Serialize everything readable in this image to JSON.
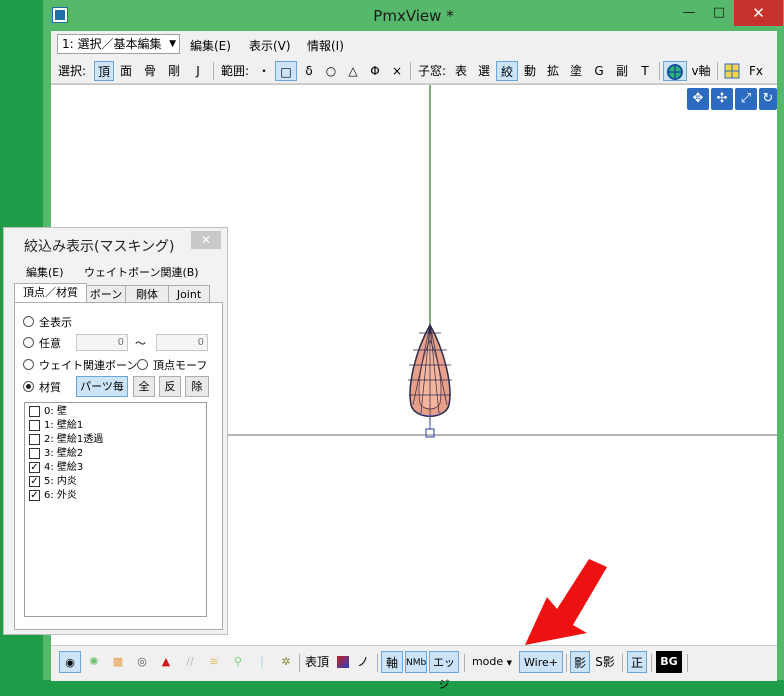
{
  "window": {
    "title": "PmxView *",
    "minimize": "—",
    "maximize": "□",
    "close": "✕"
  },
  "menubar": {
    "mode_select": "1: 選択／基本編集",
    "items": [
      "編集(E)",
      "表示(V)",
      "情報(I)"
    ]
  },
  "toolbar": {
    "select_label": "選択:",
    "select_items": [
      "頂",
      "面",
      "骨",
      "剛",
      "J"
    ],
    "range_label": "範囲:",
    "range_items": [
      "・",
      "□",
      "δ",
      "○",
      "△",
      "Φ",
      "×"
    ],
    "subwin_label": "子窓:",
    "subwin_items": [
      "表",
      "選",
      "絞",
      "動",
      "拡",
      "塗",
      "G",
      "副",
      "T"
    ],
    "v_axis": "v軸",
    "fx": "Fx"
  },
  "viewport": {
    "nav_icons": [
      "move-view-icon",
      "pan-icon",
      "zoom-icon",
      "rotate-icon"
    ]
  },
  "bottombar": {
    "surface_label": "表頂",
    "no_label": "ノ",
    "axis_label": "軸",
    "nm_label": "NMb",
    "edge_label": "エッジ",
    "mode_label": "mode",
    "wire_label": "Wire+",
    "shadow_label": "影",
    "sshadow_label": "S影",
    "ortho_label": "正",
    "bg_label": "BG"
  },
  "panel": {
    "title": "絞込み表示(マスキング)",
    "close": "✕",
    "menu": [
      "編集(E)",
      "ウェイトボーン関連(B)"
    ],
    "tabs": [
      "頂点／材質",
      "ボーン",
      "剛体",
      "Joint"
    ],
    "radio_all": "全表示",
    "radio_any": "任意",
    "any_from": "0",
    "tilde": "～",
    "any_to": "0",
    "radio_weight": "ウェイト関連ボーン",
    "radio_morph": "頂点モーフ",
    "radio_material": "材質",
    "btn_per_part": "パーツ毎",
    "btn_all": "全",
    "btn_invert": "反",
    "btn_remove": "除",
    "materials": [
      {
        "label": "0: 壁",
        "checked": false
      },
      {
        "label": "1: 壁絵1",
        "checked": false
      },
      {
        "label": "2: 壁絵1透過",
        "checked": false
      },
      {
        "label": "3: 壁絵2",
        "checked": false
      },
      {
        "label": "4: 壁絵3",
        "checked": true
      },
      {
        "label": "5: 内炎",
        "checked": true
      },
      {
        "label": "6: 外炎",
        "checked": true
      }
    ]
  },
  "colors": {
    "desktop": "#1f9c48",
    "window_border": "#56b86a",
    "close_red": "#c7312c",
    "arrow_red": "#ee1111",
    "accent_blue": "#2c6bc0"
  }
}
